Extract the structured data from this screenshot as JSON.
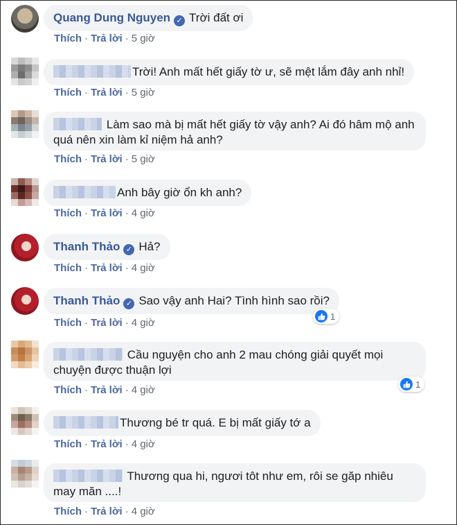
{
  "actions": {
    "like": "Thích",
    "reply": "Trả lời"
  },
  "comments": [
    {
      "author": "Quang Dung Nguyen",
      "verified": true,
      "text": "Trời đất ơi",
      "time": "5 giờ"
    },
    {
      "author": "",
      "text": "Trời! Anh mất hết giấy tờ ư, sẽ mệt lắm đây anh nhỉ!",
      "time": "5 giờ"
    },
    {
      "author": "",
      "text": "Làm sao mà bị mất hết giấy tờ vậy anh? Ai đó hâm mộ anh quá nên xin làm kỉ niệm hả anh?",
      "time": "5 giờ"
    },
    {
      "author": "",
      "text": "Anh bây giờ ổn kh anh?",
      "time": "4 giờ"
    },
    {
      "author": "Thanh Thảo",
      "verified": true,
      "text": "Hả?",
      "time": "4 giờ"
    },
    {
      "author": "Thanh Thảo",
      "verified": true,
      "text": "Sao vậy anh Hai? Tình hình sao rồi?",
      "time": "4 giờ",
      "reactions": "1"
    },
    {
      "author": "",
      "text": "Cầu nguyện cho anh 2 mau chóng giải quyết mọi chuyện được thuận lợi",
      "time": "4 giờ",
      "reactions": "1"
    },
    {
      "author": "",
      "text": "Thương bé tr quá. E bị mất giấy tớ a",
      "time": "4 giờ"
    },
    {
      "author": "",
      "text": "Thương qua hi, ngươi tôt như em, rôi se găp nhiêu may măn ....!",
      "time": "4 giờ"
    }
  ],
  "icons": {
    "verified": "verified-check-icon",
    "like": "thumbs-up-icon"
  },
  "colors": {
    "author": "#385898",
    "bubble": "#f2f3f5",
    "like_badge": "#1877f2"
  }
}
